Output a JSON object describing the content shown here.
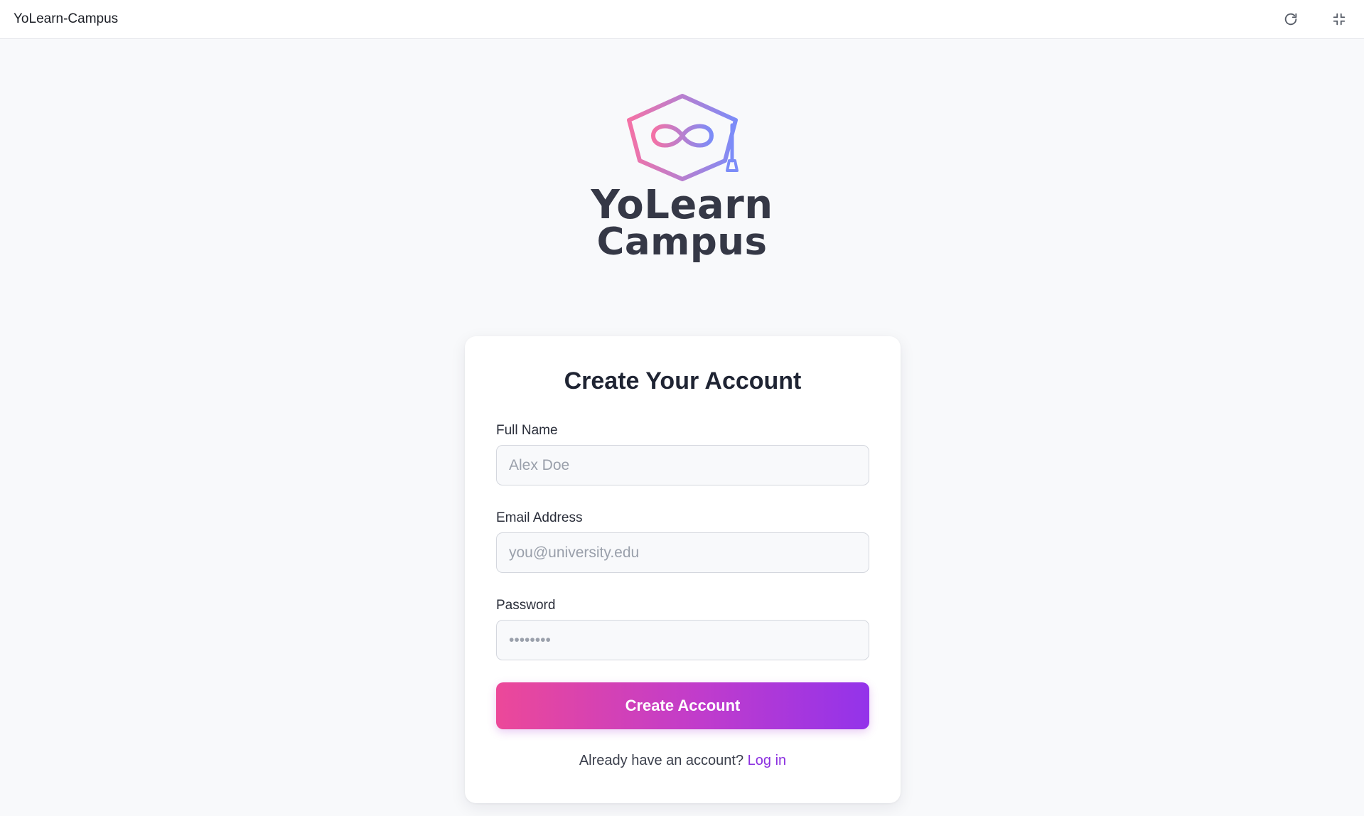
{
  "window": {
    "title": "YoLearn-Campus",
    "icons": [
      "refresh-icon",
      "exit-fullscreen-icon"
    ]
  },
  "logo": {
    "line1": "YoLearn",
    "line2": "Campus",
    "gradient_start": "#f472a6",
    "gradient_end": "#7c8cf8",
    "text_color": "#353846"
  },
  "form": {
    "title": "Create Your Account",
    "fields": {
      "full_name": {
        "label": "Full Name",
        "placeholder": "Alex Doe"
      },
      "email": {
        "label": "Email Address",
        "placeholder": "you@university.edu"
      },
      "password": {
        "label": "Password",
        "placeholder": "••••••••"
      }
    },
    "submit_label": "Create Account",
    "submit_gradient": [
      "#ec4899",
      "#9333ea"
    ],
    "login_prompt": "Already have an account?",
    "login_link": "Log in",
    "link_color": "#8b2fe0"
  }
}
